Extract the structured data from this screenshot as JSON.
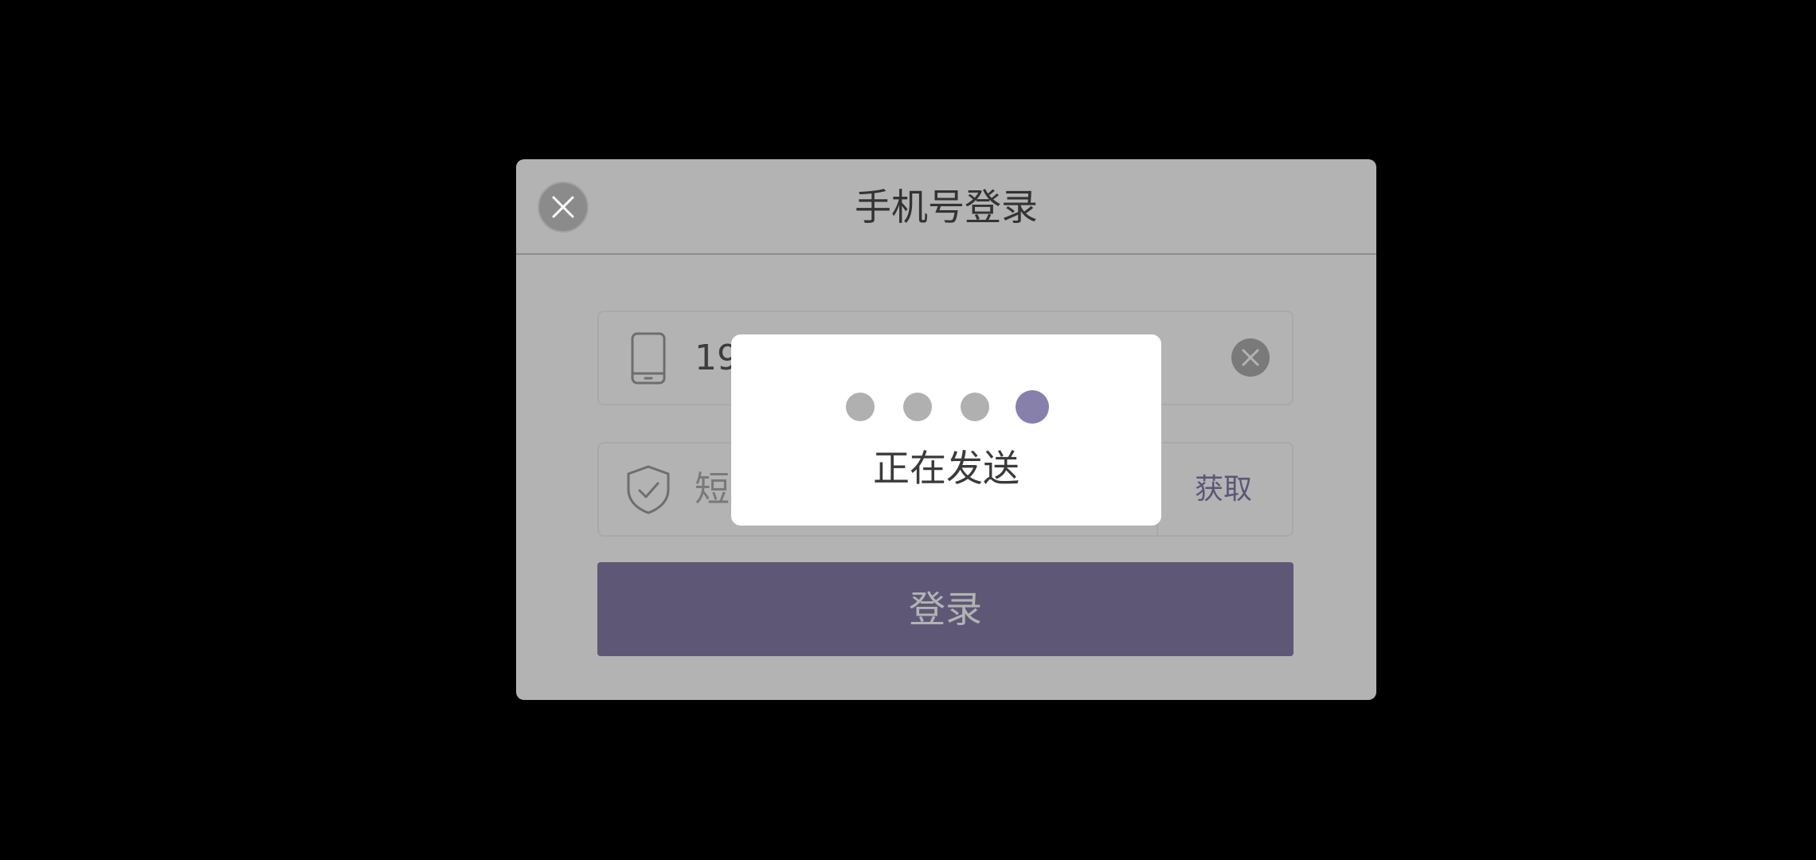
{
  "dialog": {
    "title": "手机号登录",
    "phone_field": {
      "value": "19"
    },
    "code_field": {
      "placeholder": "短",
      "get_code_label": "获取"
    },
    "login_label": "登录"
  },
  "toast": {
    "text": "正在发送",
    "dots": 4,
    "active_dot": 4
  },
  "colors": {
    "accent": "#5e5876",
    "active_dot": "#8680aa",
    "overlay_dialog": "#b3b3b3",
    "background": "#000000"
  },
  "icons": {
    "close": "close-icon",
    "phone": "smartphone-icon",
    "shield": "shield-check-icon",
    "clear": "clear-icon"
  }
}
